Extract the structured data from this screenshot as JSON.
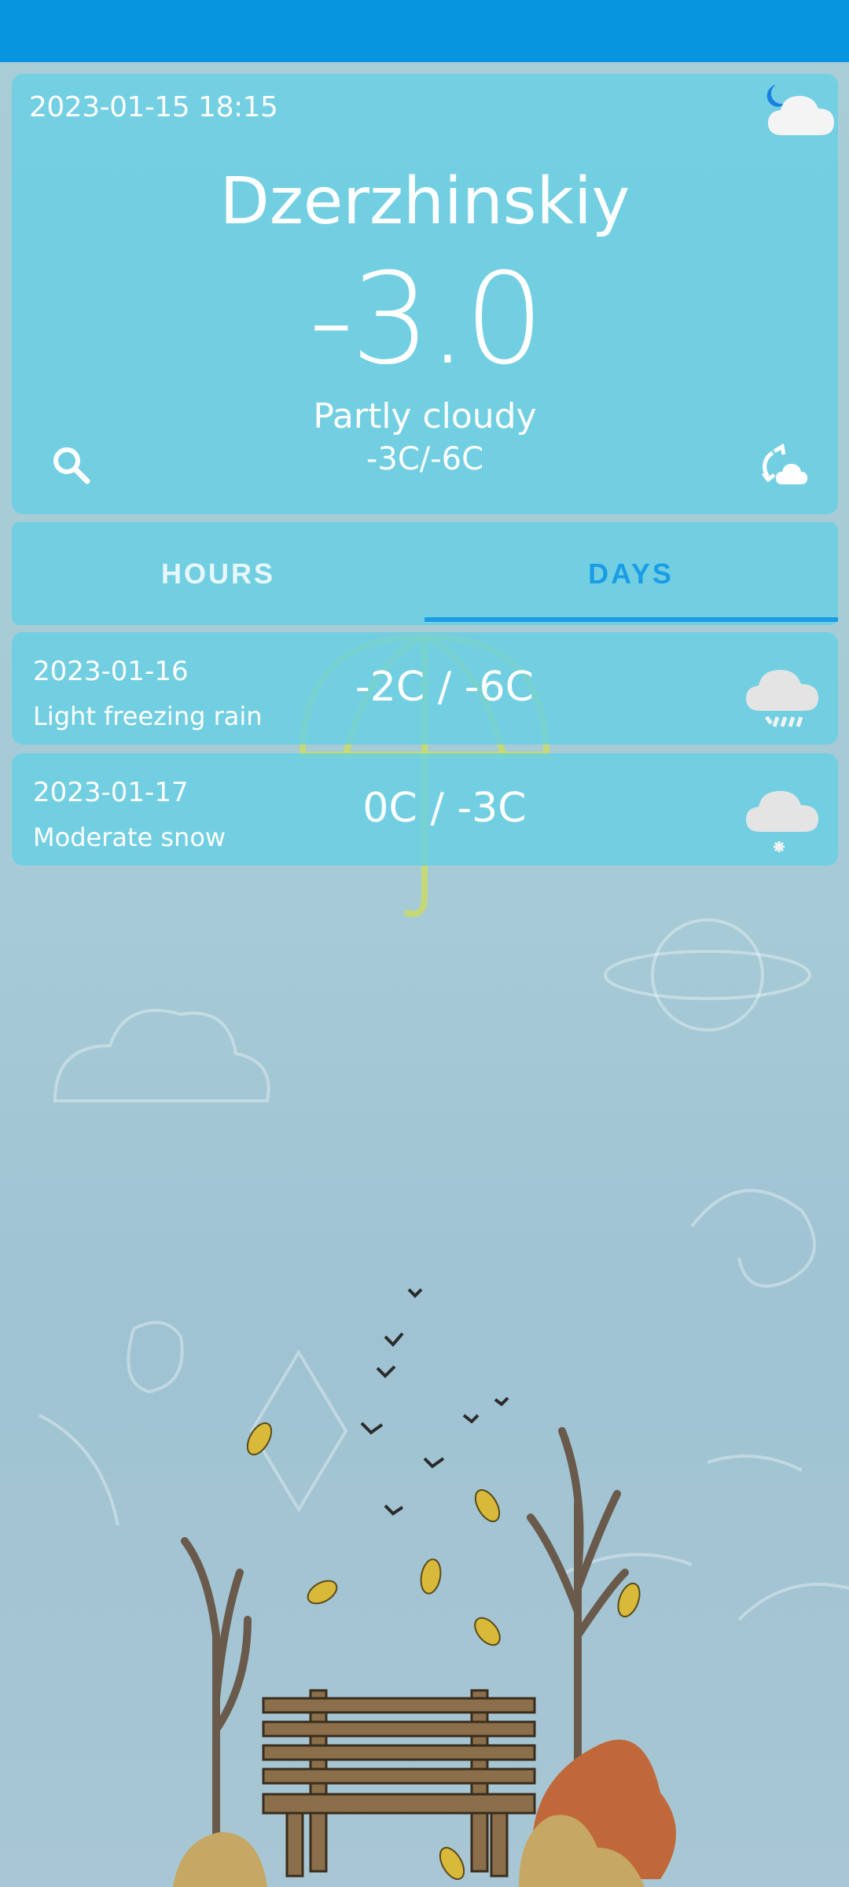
{
  "colors": {
    "status_bar": "#0795e0",
    "card": "#66d0e4",
    "tab_active": "#1a9de6"
  },
  "current": {
    "datetime": "2023-01-15 18:15",
    "city": "Dzerzhinskiy",
    "temperature": "-3.0",
    "condition": "Partly cloudy",
    "range": "-3C/-6C",
    "icon": "partly-cloudy-night-icon"
  },
  "tabs": [
    {
      "label": "HOURS",
      "selected": false
    },
    {
      "label": "DAYS",
      "selected": true
    }
  ],
  "days": [
    {
      "date": "2023-01-16",
      "condition": "Light freezing rain",
      "range": "-2C / -6C",
      "icon": "freezing-rain-icon"
    },
    {
      "date": "2023-01-17",
      "condition": "Moderate snow",
      "range": "0C / -3C",
      "icon": "snow-icon"
    }
  ]
}
